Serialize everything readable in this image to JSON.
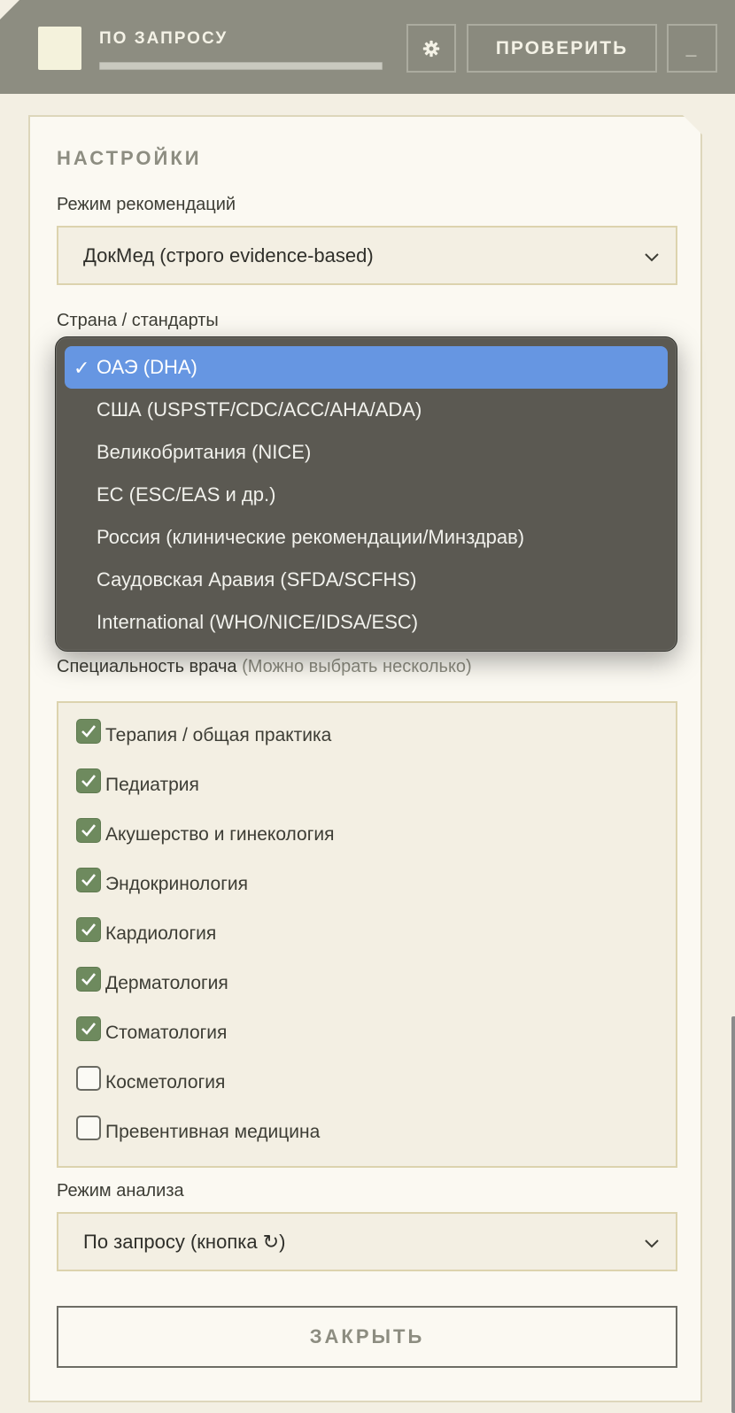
{
  "header": {
    "mode_label": "ПО ЗАПРОСУ",
    "progress_fraction": 1.0,
    "settings_icon": "gear-icon",
    "check_button": "ПРОВЕРИТЬ",
    "minimize_button": "_"
  },
  "settings": {
    "title": "НАСТРОЙКИ",
    "recommendation_mode": {
      "label": "Режим рекомендаций",
      "value": "ДокМед (строго evidence-based)"
    },
    "country": {
      "label": "Страна / стандарты",
      "options": [
        "ОАЭ (DHA)",
        "США (USPSTF/CDC/ACC/AHA/ADA)",
        "Великобритания (NICE)",
        "ЕС (ESC/EAS и др.)",
        "Россия (клинические рекомендации/Минздрав)",
        "Саудовская Аравия (SFDA/SCFHS)",
        "International (WHO/NICE/IDSA/ESC)"
      ],
      "selected_index": 0,
      "check_glyph": "✓"
    },
    "specialty": {
      "label": "Специальность врача",
      "hint": "(Можно выбрать несколько)",
      "items": [
        {
          "label": "Терапия / общая практика",
          "checked": true
        },
        {
          "label": "Педиатрия",
          "checked": true
        },
        {
          "label": "Акушерство и гинекология",
          "checked": true
        },
        {
          "label": "Эндокринология",
          "checked": true
        },
        {
          "label": "Кардиология",
          "checked": true
        },
        {
          "label": "Дерматология",
          "checked": true
        },
        {
          "label": "Стоматология",
          "checked": true
        },
        {
          "label": "Косметология",
          "checked": false
        },
        {
          "label": "Превентивная медицина",
          "checked": false
        }
      ]
    },
    "analysis_mode": {
      "label": "Режим анализа",
      "value": "По запросу (кнопка ↻)"
    },
    "close_button": "ЗАКРЫТЬ"
  },
  "colors": {
    "header_bg": "#8d8d81",
    "panel_bg": "#fbf9f2",
    "field_bg": "#f3efe3",
    "checkbox_on": "#6e8a5e",
    "popup_selected": "#6696e2"
  }
}
